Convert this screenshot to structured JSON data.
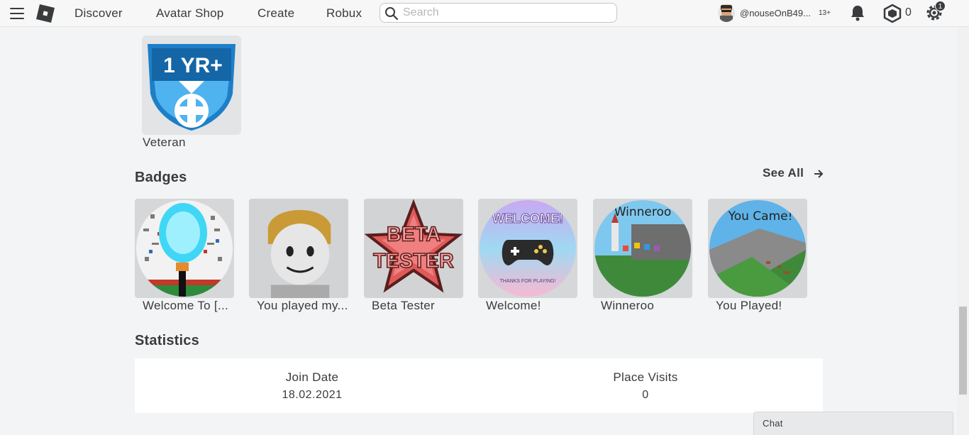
{
  "nav": {
    "links": [
      "Discover",
      "Avatar Shop",
      "Create",
      "Robux"
    ],
    "search_placeholder": "Search",
    "username": "@nouseOnB49...",
    "age_badge": "13+",
    "robux_count": "0",
    "settings_notification": "1"
  },
  "veteran": {
    "badge_text": "1 YR+",
    "label": "Veteran"
  },
  "badges": {
    "title": "Badges",
    "see_all": "See All",
    "items": [
      {
        "name": "Welcome To [..."
      },
      {
        "name": "You played my..."
      },
      {
        "name": "Beta Tester",
        "thumb_text_1": "BETA",
        "thumb_text_2": "TESTER"
      },
      {
        "name": "Welcome!",
        "thumb_text": "WELCOME!",
        "thumb_subtext": "THANKS FOR PLAYING!"
      },
      {
        "name": "Winneroo",
        "thumb_text": "Winneroo"
      },
      {
        "name": "You Played!",
        "thumb_text": "You Came!"
      }
    ]
  },
  "statistics": {
    "title": "Statistics",
    "join_date_label": "Join Date",
    "join_date_value": "18.02.2021",
    "place_visits_label": "Place Visits",
    "place_visits_value": "0"
  },
  "chat": {
    "label": "Chat"
  },
  "colors": {
    "background": "#f2f4f5",
    "text": "#393b3d",
    "veteran_blue": "#1d7fc8"
  }
}
